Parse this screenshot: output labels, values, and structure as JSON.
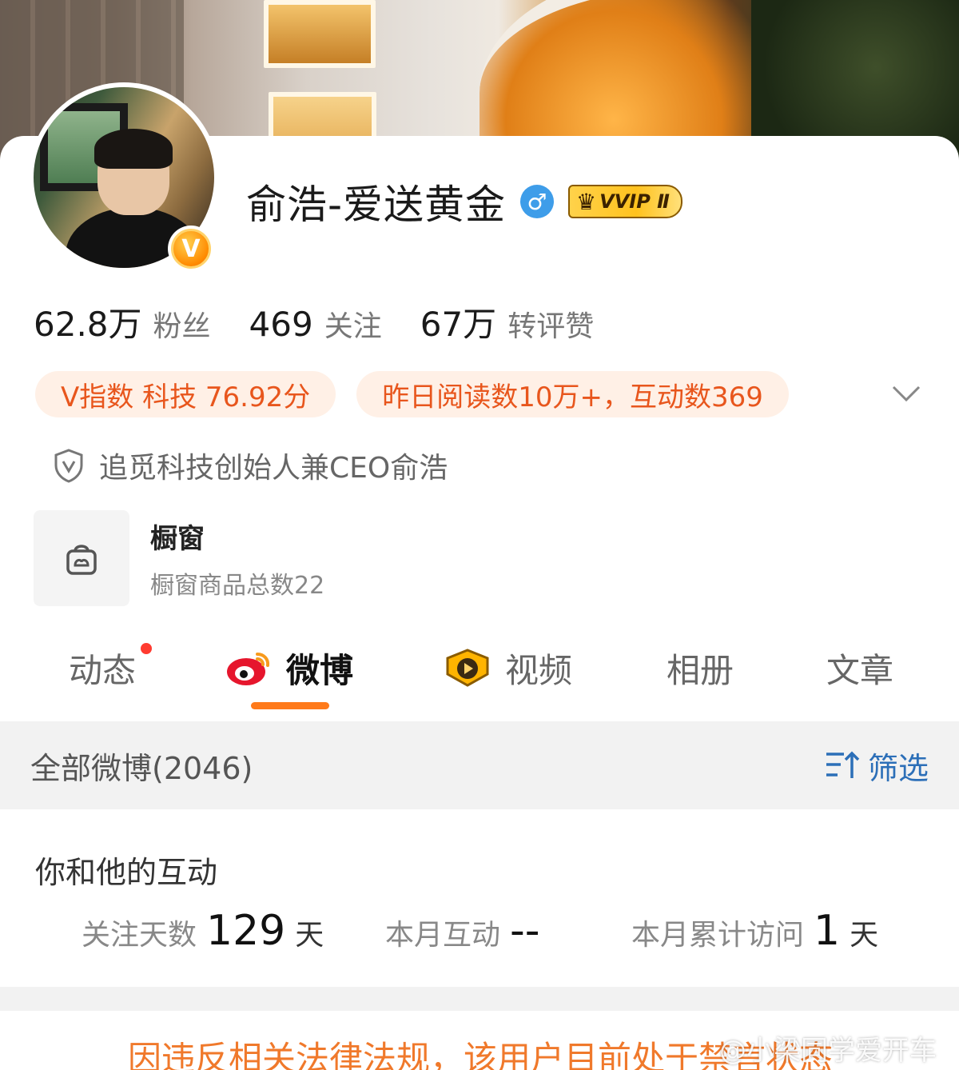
{
  "profile": {
    "name": "俞浩-爱送黄金",
    "gender_symbol": "♂",
    "vvip_label": "VVIP Ⅱ",
    "verified_badge": "V"
  },
  "stats": [
    {
      "value": "62.8万",
      "label": "粉丝"
    },
    {
      "value": "469",
      "label": "关注"
    },
    {
      "value": "67万",
      "label": "转评赞"
    }
  ],
  "chips": [
    "V指数 科技 76.92分",
    "昨日阅读数10万+，互动数369"
  ],
  "verification": {
    "icon": "shield-v-icon",
    "text": "追觅科技创始人兼CEO俞浩"
  },
  "shop": {
    "icon": "shopping-bag-icon",
    "title": "橱窗",
    "subtitle": "橱窗商品总数22"
  },
  "tabs": [
    {
      "label": "动态",
      "has_dot": true
    },
    {
      "label": "微博",
      "active": true,
      "icon": "weibo-icon"
    },
    {
      "label": "视频",
      "icon": "video-play-icon"
    },
    {
      "label": "相册"
    },
    {
      "label": "文章"
    }
  ],
  "feed_header": {
    "all_label": "全部微博(2046)",
    "filter_label": "筛选"
  },
  "interaction": {
    "title": "你和他的互动",
    "items": [
      {
        "label": "关注天数",
        "value": "129",
        "unit": "天"
      },
      {
        "label": "本月互动",
        "value": "--",
        "unit": ""
      },
      {
        "label": "本月累计访问",
        "value": "1",
        "unit": "天"
      }
    ]
  },
  "notice": "因违反相关法律法规，该用户目前处于禁言状态",
  "watermark": "@小梁同学爱开车",
  "colors": {
    "accent": "#ff7a1a",
    "chip_text": "#e8561d",
    "chip_bg": "#fff0e6",
    "filter_blue": "#2c6fb8",
    "notice": "#f0792b"
  }
}
